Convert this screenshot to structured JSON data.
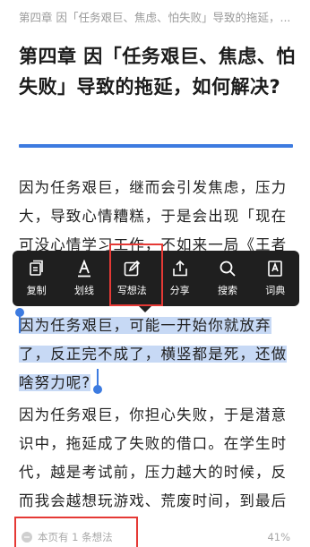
{
  "header": {
    "breadcrumb": "第四章 因「任务艰巨、焦虑、怕失败」导致的拖延，..."
  },
  "chapter": {
    "title": "第四章 因「任务艰巨、焦虑、怕失败」导致的拖延，如何解决?"
  },
  "content": {
    "paragraph1": "因为任务艰巨，继而会引发焦虑，压力大，导致心情糟糕，于是会出现「现在可没心情学习工作，不如来一局《王者",
    "paragraph2_selected": "因为任务艰巨，可能一开始你就放弃了，反正完不成了，横竖都是死，还做啥努力呢?",
    "paragraph3": "因为任务艰巨，你担心失败，于是潜意识中，拖延成了失败的借口。在学生时代，越是考试前，压力越大的时候，反而我会越想玩游戏、荒废时间，到最后"
  },
  "toolbar": {
    "items": [
      {
        "label": "复制",
        "icon": "copy-icon"
      },
      {
        "label": "划线",
        "icon": "underline-icon"
      },
      {
        "label": "写想法",
        "icon": "write-note-icon"
      },
      {
        "label": "分享",
        "icon": "share-icon"
      },
      {
        "label": "搜索",
        "icon": "search-icon"
      },
      {
        "label": "词典",
        "icon": "dictionary-icon"
      }
    ]
  },
  "footer": {
    "notes": "本页有 1 条想法",
    "progress": "41%"
  },
  "colors": {
    "accent": "#3d7be0",
    "highlight": "#c7d9f5",
    "toolbar_bg": "#1f1f1f",
    "annotation_red": "#e53935"
  }
}
